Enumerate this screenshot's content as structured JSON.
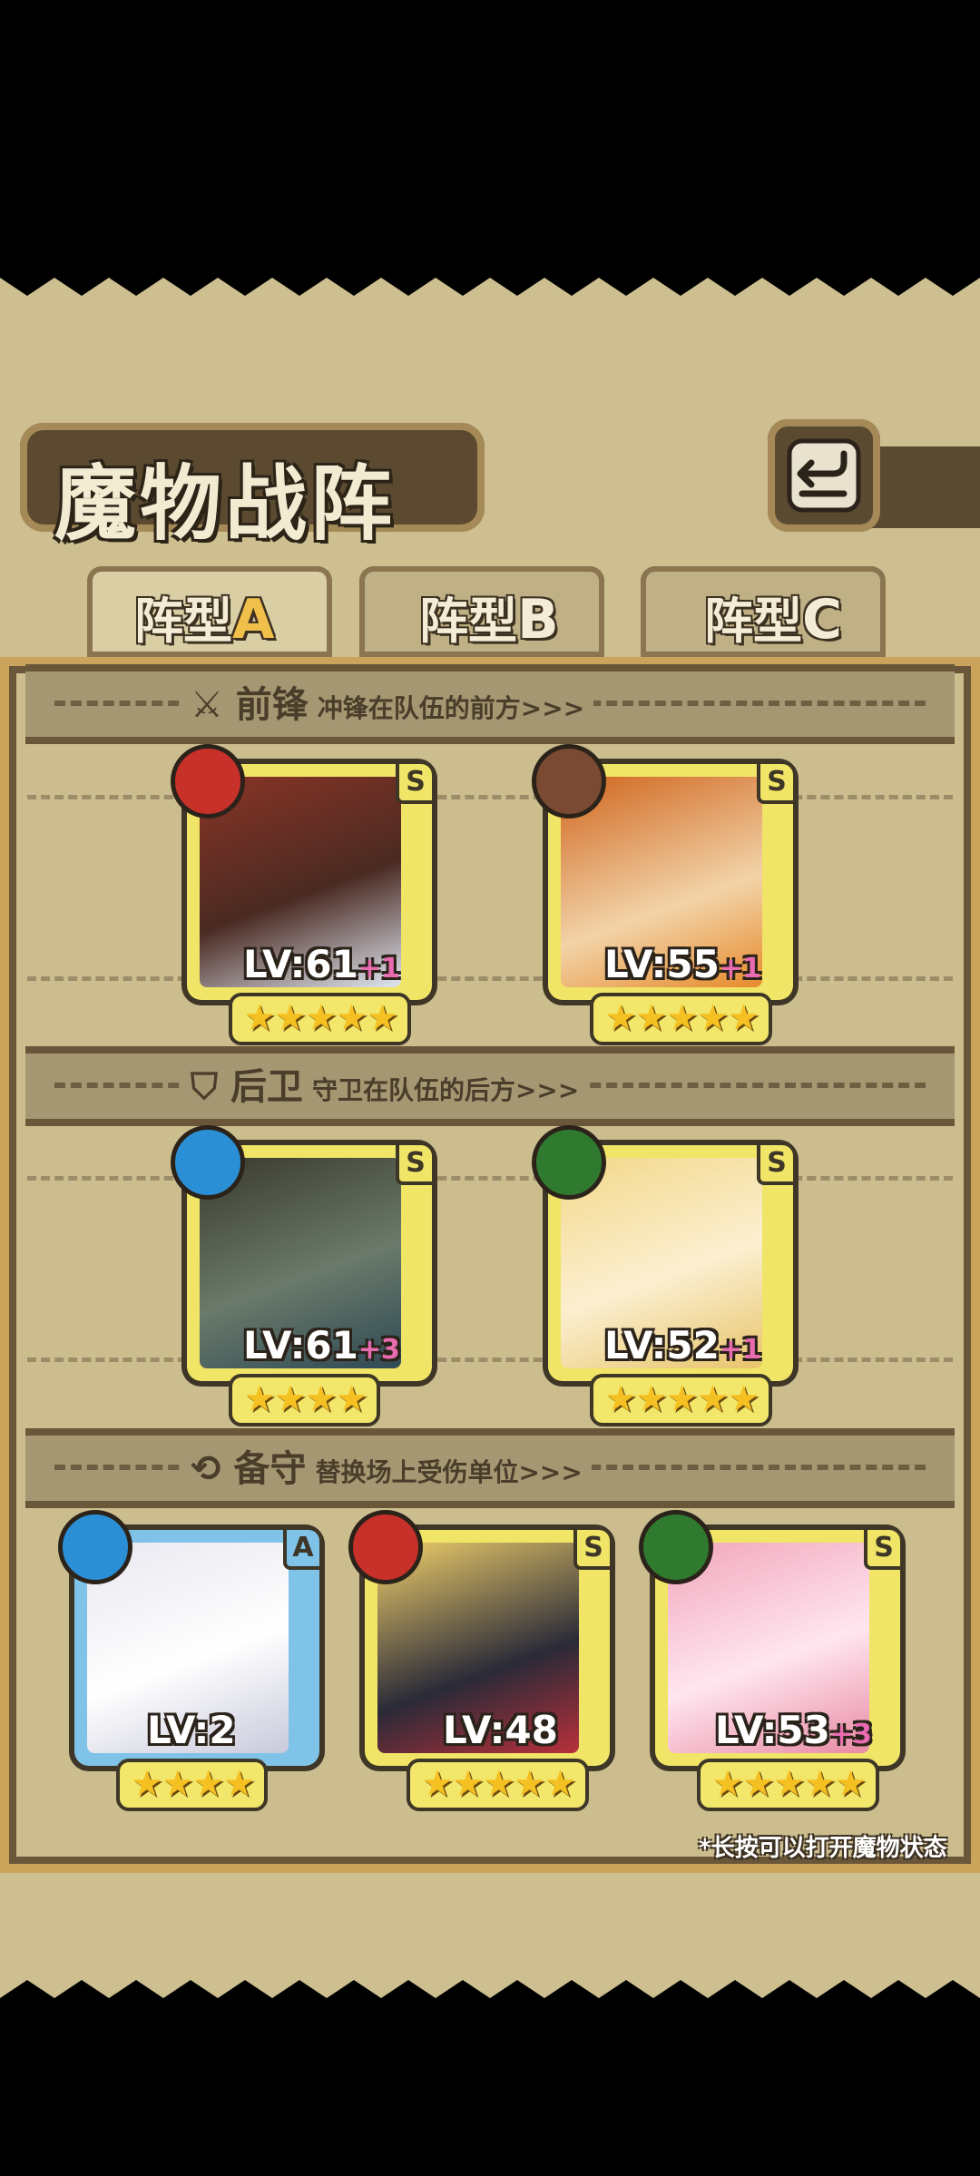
{
  "header": {
    "title": "魔物战阵"
  },
  "tabs": [
    {
      "prefix": "阵型",
      "letter": "A"
    },
    {
      "prefix": "阵型",
      "letter": "B"
    },
    {
      "prefix": "阵型",
      "letter": "C"
    }
  ],
  "sections": {
    "front": {
      "title": "前锋",
      "subtitle": "冲锋在队伍的前方>>>"
    },
    "back": {
      "title": "后卫",
      "subtitle": "守卫在队伍的后方>>>"
    },
    "reserve": {
      "title": "备守",
      "subtitle": "替换场上受伤单位>>>"
    }
  },
  "units": {
    "front": [
      {
        "level": "LV:61",
        "bonus": "+1",
        "rank": "S",
        "stars": "★★★★★",
        "element": "fire"
      },
      {
        "level": "LV:55",
        "bonus": "+1",
        "rank": "S",
        "stars": "★★★★★",
        "element": "earth"
      }
    ],
    "back": [
      {
        "level": "LV:61",
        "bonus": "+3",
        "rank": "S",
        "stars": "★★★★",
        "element": "water"
      },
      {
        "level": "LV:52",
        "bonus": "+1",
        "rank": "S",
        "stars": "★★★★★",
        "element": "nature"
      }
    ],
    "reserve": [
      {
        "level": "LV:2",
        "bonus": "",
        "rank": "A",
        "stars": "★★★★",
        "element": "water"
      },
      {
        "level": "LV:48",
        "bonus": "",
        "rank": "S",
        "stars": "★★★★★",
        "element": "fire"
      },
      {
        "level": "LV:53",
        "bonus": "+3",
        "rank": "S",
        "stars": "★★★★★",
        "element": "nature"
      }
    ]
  },
  "footer_note": "*长按可以打开魔物状态",
  "colors": {
    "fire": "#c8302a",
    "earth": "#7a4a32",
    "water": "#2b8fd6",
    "nature": "#2f7a2f"
  }
}
